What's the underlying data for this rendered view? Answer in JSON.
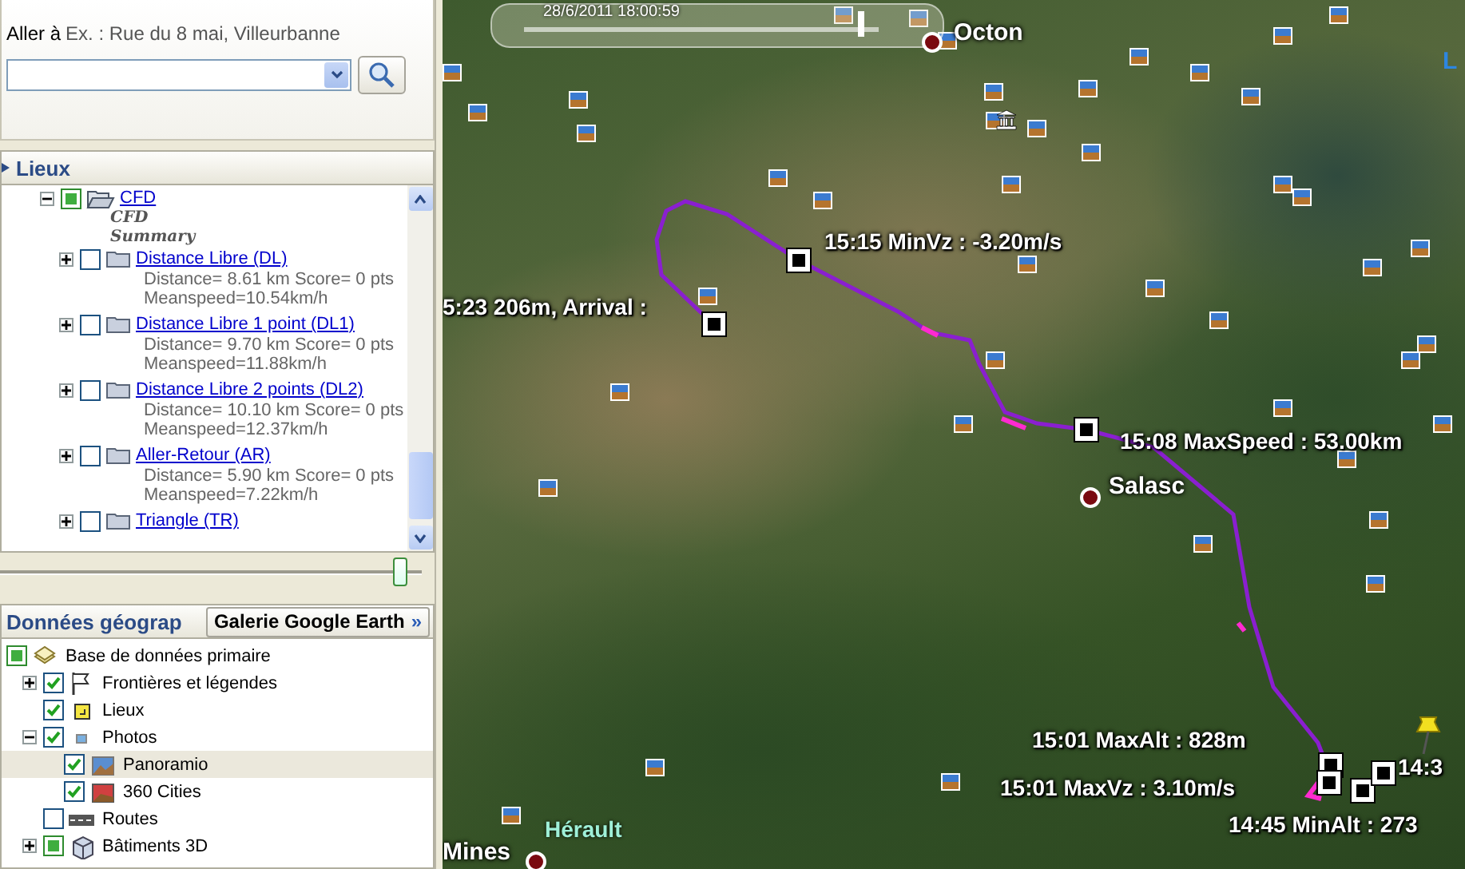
{
  "search": {
    "label": "Aller à",
    "hint": "Ex. : Rue du 8 mai, Villeurbanne"
  },
  "places": {
    "title": "Lieux",
    "tree": [
      {
        "label": "CFD",
        "checked": false,
        "partial": true,
        "expanded": true,
        "notes": [
          "CFD",
          "Summary"
        ],
        "children": [
          {
            "label": "Distance Libre (DL)",
            "checked": false,
            "partial": false,
            "expanded": false,
            "details": [
              "Distance= 8.61 km Score= 0 pts",
              "Meanspeed=10.54km/h"
            ]
          },
          {
            "label": "Distance Libre 1 point (DL1)",
            "checked": false,
            "partial": false,
            "expanded": false,
            "details": [
              "Distance= 9.70 km Score= 0 pts",
              "Meanspeed=11.88km/h"
            ]
          },
          {
            "label": "Distance Libre 2 points (DL2)",
            "checked": false,
            "partial": false,
            "expanded": false,
            "details": [
              "Distance= 10.10 km Score= 0 pts",
              "Meanspeed=12.37km/h"
            ]
          },
          {
            "label": "Aller-Retour (AR)",
            "checked": false,
            "partial": false,
            "expanded": false,
            "details": [
              "Distance= 5.90 km Score= 0 pts",
              "Meanspeed=7.22km/h"
            ]
          },
          {
            "label": "Triangle (TR)",
            "checked": false,
            "partial": false,
            "expanded": false
          }
        ]
      }
    ],
    "opacity_slider": {
      "level": 0.95
    }
  },
  "layers": {
    "title": "Données géograp",
    "gallery_button": "Galerie Google Earth",
    "gallery_arrows": "»",
    "tree": [
      {
        "label": "Base de données primaire",
        "kind": "database",
        "checked": false,
        "partial": true,
        "selected": false,
        "children": [
          {
            "label": "Frontières et légendes",
            "kind": "flag",
            "checked": true,
            "partial": false,
            "expanded": false,
            "selected": false
          },
          {
            "label": "Lieux",
            "kind": "place",
            "checked": true,
            "partial": false,
            "selected": false
          },
          {
            "label": "Photos",
            "kind": "photos",
            "checked": true,
            "partial": false,
            "expanded": true,
            "selected": false,
            "children": [
              {
                "label": "Panoramio",
                "kind": "photo",
                "checked": true,
                "partial": false,
                "selected": true
              },
              {
                "label": "360 Cities",
                "kind": "panorama",
                "checked": true,
                "partial": false,
                "selected": false
              }
            ]
          },
          {
            "label": "Routes",
            "kind": "road",
            "checked": false,
            "partial": false,
            "selected": false
          },
          {
            "label": "Bâtiments 3D",
            "kind": "building",
            "checked": false,
            "partial": true,
            "expanded": false,
            "selected": false
          }
        ]
      }
    ]
  },
  "map": {
    "timeline": {
      "date": "28/6/2011 18:00:59",
      "level": 0.95
    },
    "places": [
      {
        "name": "Octon",
        "kind": "town"
      },
      {
        "name": "Salasc",
        "kind": "town"
      },
      {
        "name": "Hérault",
        "kind": "region"
      },
      {
        "name": "Mines",
        "kind": "town"
      },
      {
        "name": "L",
        "kind": "water"
      }
    ],
    "track_labels": [
      "15:15 MinVz : -3.20m/s",
      "5:23 206m, Arrival :",
      "15:08 MaxSpeed : 53.00km",
      "15:01 MaxAlt : 828m",
      "15:01 MaxVz : 3.10m/s",
      "14:45 MinAlt : 273",
      "14:3"
    ]
  }
}
